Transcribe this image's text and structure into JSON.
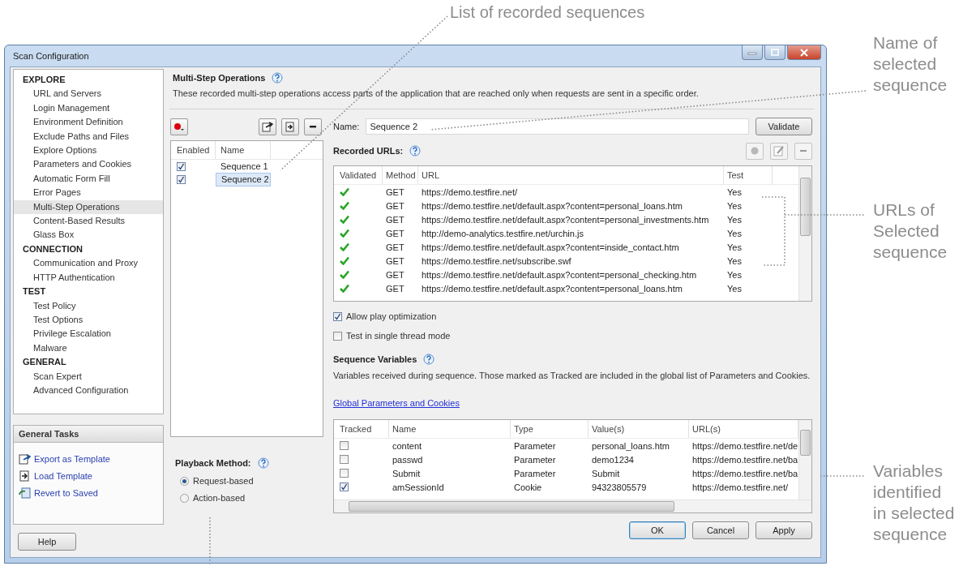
{
  "top_callout": "List of recorded sequences",
  "side_callouts": [
    "Name of selected sequence",
    "URLs of Selected sequence",
    "Variables identified in selected sequence"
  ],
  "window": {
    "title": "Scan Configuration"
  },
  "sidebar": {
    "sections": [
      {
        "title": "EXPLORE",
        "items": [
          {
            "label": "URL and Servers",
            "selected": false
          },
          {
            "label": "Login Management",
            "selected": false
          },
          {
            "label": "Environment Definition",
            "selected": false
          },
          {
            "label": "Exclude Paths and Files",
            "selected": false
          },
          {
            "label": "Explore Options",
            "selected": false
          },
          {
            "label": "Parameters and Cookies",
            "selected": false
          },
          {
            "label": "Automatic Form Fill",
            "selected": false
          },
          {
            "label": "Error Pages",
            "selected": false
          },
          {
            "label": "Multi-Step Operations",
            "selected": true
          },
          {
            "label": "Content-Based Results",
            "selected": false
          },
          {
            "label": "Glass Box",
            "selected": false
          }
        ]
      },
      {
        "title": "CONNECTION",
        "items": [
          {
            "label": "Communication and Proxy",
            "selected": false
          },
          {
            "label": "HTTP Authentication",
            "selected": false
          }
        ]
      },
      {
        "title": "TEST",
        "items": [
          {
            "label": "Test Policy",
            "selected": false
          },
          {
            "label": "Test Options",
            "selected": false
          },
          {
            "label": "Privilege Escalation",
            "selected": false
          },
          {
            "label": "Malware",
            "selected": false
          }
        ]
      },
      {
        "title": "GENERAL",
        "items": [
          {
            "label": "Scan Expert",
            "selected": false
          },
          {
            "label": "Advanced Configuration",
            "selected": false
          }
        ]
      }
    ]
  },
  "general_tasks": {
    "title": "General Tasks",
    "items": [
      {
        "kind": "export",
        "label": "Export as Template"
      },
      {
        "kind": "load",
        "label": "Load Template"
      },
      {
        "kind": "revert",
        "label": "Revert to Saved"
      }
    ]
  },
  "help_button": "Help",
  "section": {
    "title": "Multi-Step Operations",
    "description": "These recorded multi-step operations access parts of the application that are reached only when requests are sent in a specific order."
  },
  "sequences": {
    "columns": [
      "Enabled",
      "Name"
    ],
    "rows": [
      {
        "name": "Sequence 1",
        "enabled": true,
        "selected": false
      },
      {
        "name": "Sequence 2",
        "enabled": true,
        "selected": true
      }
    ]
  },
  "playback": {
    "title": "Playback Method:",
    "options": [
      {
        "label": "Request-based",
        "selected": true
      },
      {
        "label": "Action-based",
        "selected": false
      }
    ]
  },
  "name_field": {
    "label": "Name:",
    "value": "Sequence 2"
  },
  "validate_button": "Validate",
  "recorded_urls": {
    "title": "Recorded URLs:",
    "columns": [
      "Validated",
      "Method",
      "URL",
      "Test"
    ],
    "rows": [
      {
        "validated": true,
        "method": "GET",
        "url": "https://demo.testfire.net/",
        "test": "Yes"
      },
      {
        "validated": true,
        "method": "GET",
        "url": "https://demo.testfire.net/default.aspx?content=personal_loans.htm",
        "test": "Yes"
      },
      {
        "validated": true,
        "method": "GET",
        "url": "https://demo.testfire.net/default.aspx?content=personal_investments.htm",
        "test": "Yes"
      },
      {
        "validated": true,
        "method": "GET",
        "url": "http://demo-analytics.testfire.net/urchin.js",
        "test": "Yes"
      },
      {
        "validated": true,
        "method": "GET",
        "url": "https://demo.testfire.net/default.aspx?content=inside_contact.htm",
        "test": "Yes"
      },
      {
        "validated": true,
        "method": "GET",
        "url": "https://demo.testfire.net/subscribe.swf",
        "test": "Yes"
      },
      {
        "validated": true,
        "method": "GET",
        "url": "https://demo.testfire.net/default.aspx?content=personal_checking.htm",
        "test": "Yes"
      },
      {
        "validated": true,
        "method": "GET",
        "url": "https://demo.testfire.net/default.aspx?content=personal_loans.htm",
        "test": "Yes"
      }
    ]
  },
  "options": [
    {
      "label": "Allow play optimization",
      "checked": true
    },
    {
      "label": "Test in single thread mode",
      "checked": false
    }
  ],
  "variables": {
    "title": "Sequence Variables",
    "description": "Variables received during sequence. Those marked as Tracked are included in the global list of Parameters and Cookies.",
    "link": "Global Parameters and Cookies",
    "columns": [
      "Tracked",
      "Name",
      "Type",
      "Value(s)",
      "URL(s)"
    ],
    "rows": [
      {
        "tracked": false,
        "name": "content",
        "type": "Parameter",
        "value": "personal_loans.htm",
        "url": "https://demo.testfire.net/de"
      },
      {
        "tracked": false,
        "name": "passwd",
        "type": "Parameter",
        "value": "demo1234",
        "url": "https://demo.testfire.net/ba"
      },
      {
        "tracked": false,
        "name": "Submit",
        "type": "Parameter",
        "value": "Submit",
        "url": "https://demo.testfire.net/ba"
      },
      {
        "tracked": true,
        "name": "amSessionId",
        "type": "Cookie",
        "value": "94323805579",
        "url": "https://demo.testfire.net/"
      }
    ]
  },
  "buttons": [
    "OK",
    "Cancel",
    "Apply"
  ]
}
